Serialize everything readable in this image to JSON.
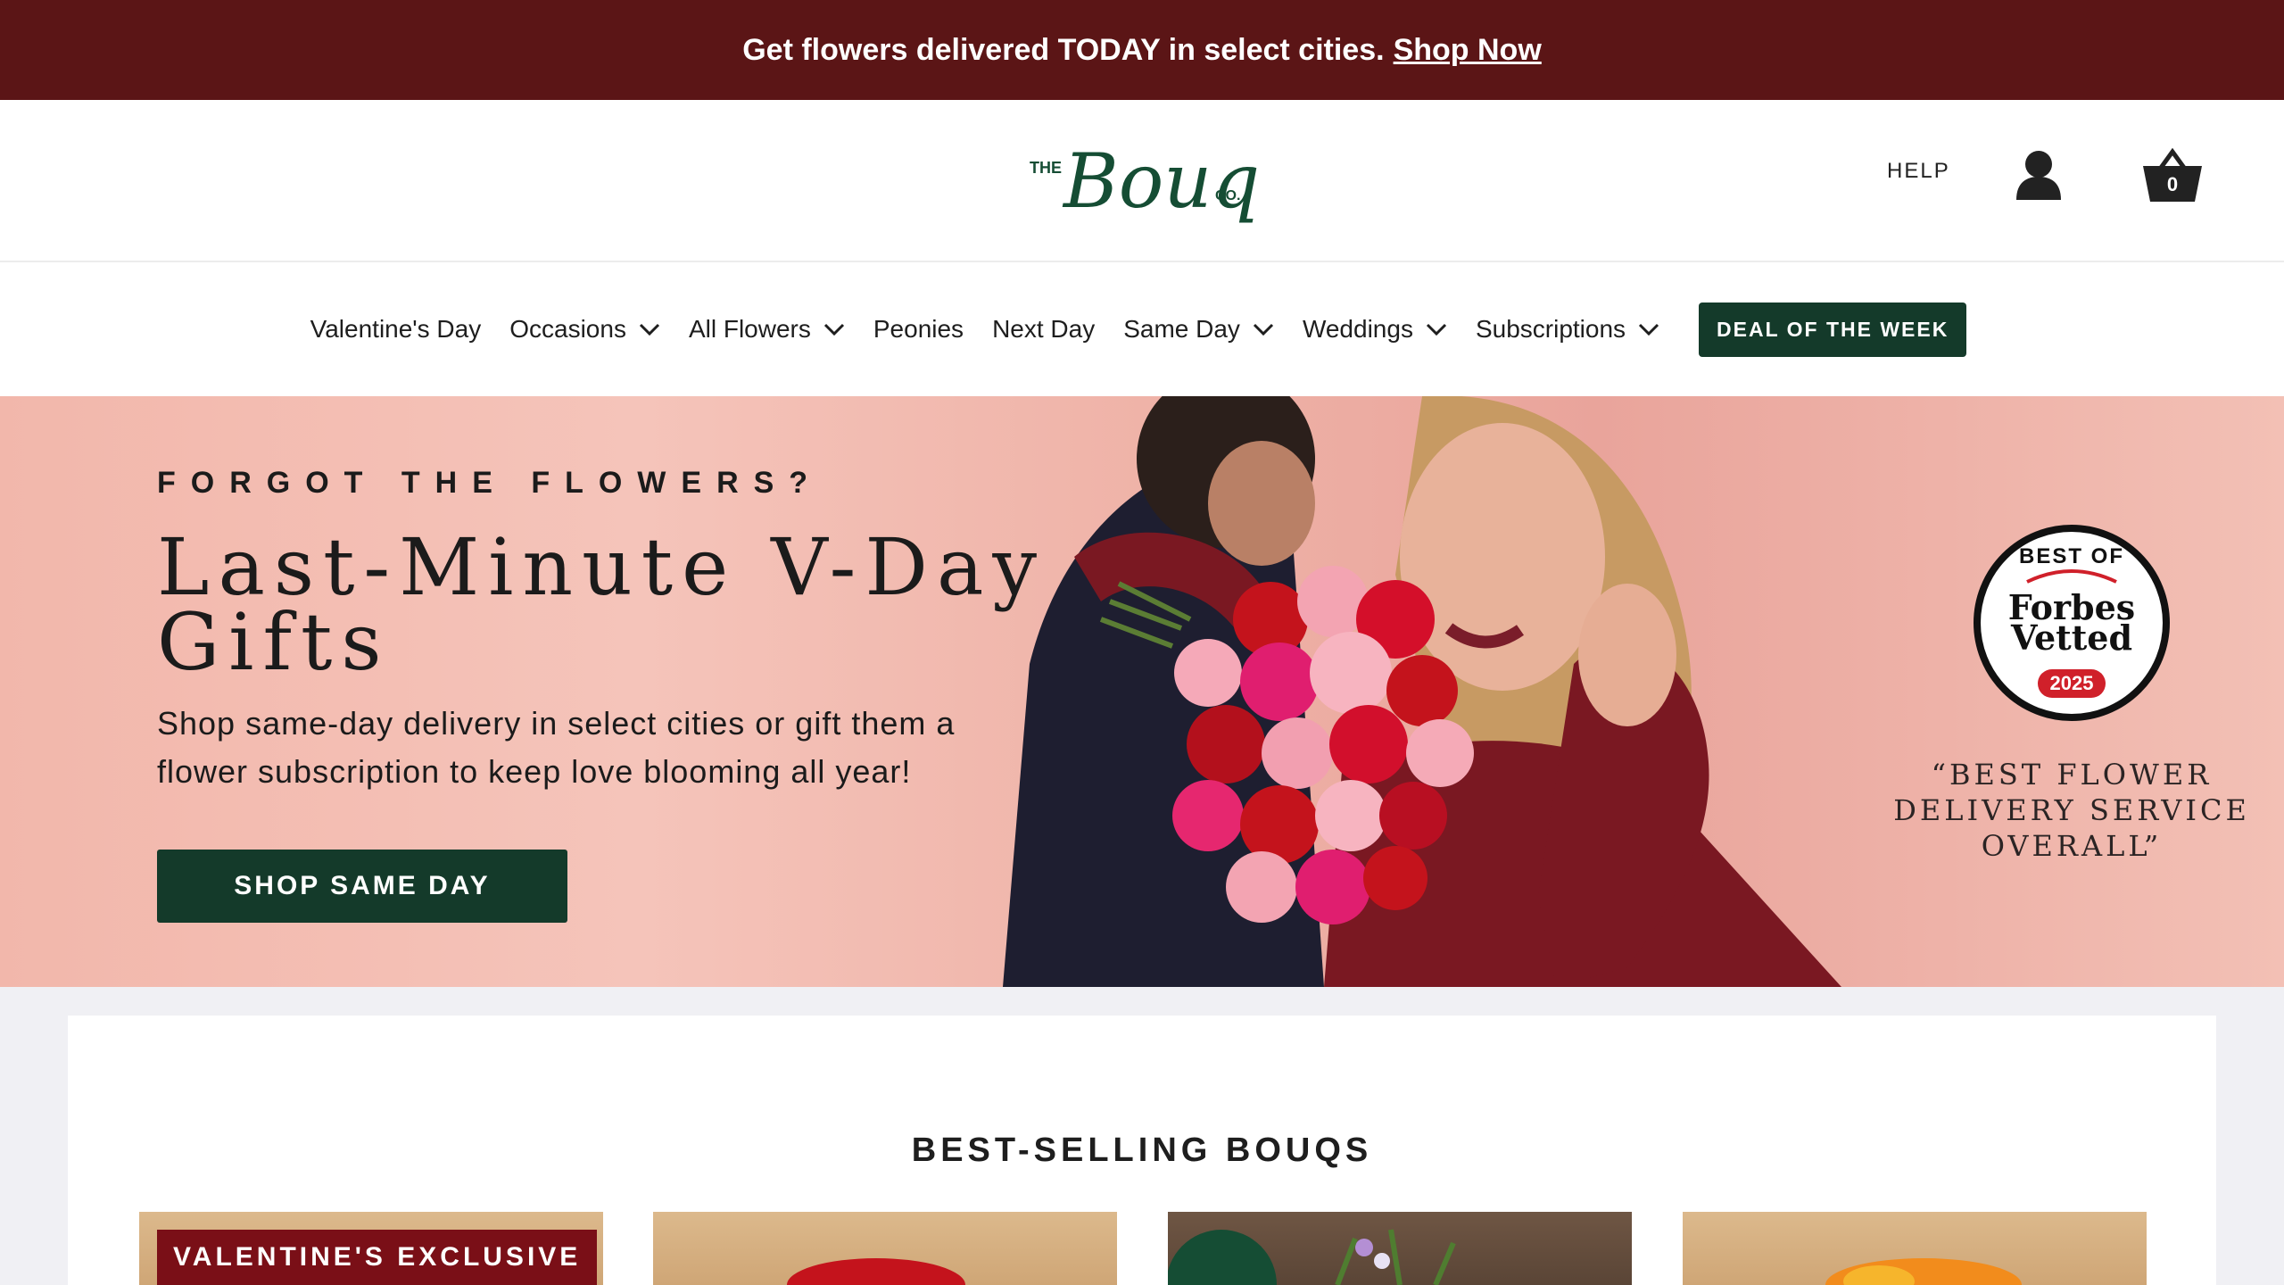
{
  "announcement": {
    "text": "Get flowers delivered TODAY in select cities.",
    "link": "Shop Now"
  },
  "header": {
    "logo_the": "THE",
    "logo_name": "Bouqs",
    "logo_co": "CO.",
    "help": "HELP",
    "cart_count": "0"
  },
  "nav": {
    "items": [
      {
        "label": "Valentine's Day",
        "has_dropdown": false
      },
      {
        "label": "Occasions",
        "has_dropdown": true
      },
      {
        "label": "All Flowers",
        "has_dropdown": true
      },
      {
        "label": "Peonies",
        "has_dropdown": false
      },
      {
        "label": "Next Day",
        "has_dropdown": false
      },
      {
        "label": "Same Day",
        "has_dropdown": true
      },
      {
        "label": "Weddings",
        "has_dropdown": true
      },
      {
        "label": "Subscriptions",
        "has_dropdown": true
      }
    ],
    "deal": "DEAL OF THE WEEK"
  },
  "hero": {
    "eyebrow": "FORGOT THE FLOWERS?",
    "title": "Last-Minute V-Day Gifts",
    "text": "Shop same-day delivery in select cities or gift them a flower subscription to keep love blooming all year!",
    "button": "SHOP SAME DAY",
    "badge_best_of": "BEST OF",
    "badge_forbes": "Forbes Vetted",
    "badge_year": "2025",
    "quote": "“BEST FLOWER DELIVERY SERVICE OVERALL”"
  },
  "best_sellers": {
    "title": "BEST-SELLING BOUQS",
    "card_badge": "VALENTINE'S EXCLUSIVE"
  },
  "colors": {
    "announce_bg": "#5b1516",
    "brand_green": "#143a2a",
    "hero_bg": "#f2b7ab",
    "badge_red": "#d0202a"
  },
  "icons": [
    "user-icon",
    "basket-icon",
    "chevron-down-icon"
  ]
}
